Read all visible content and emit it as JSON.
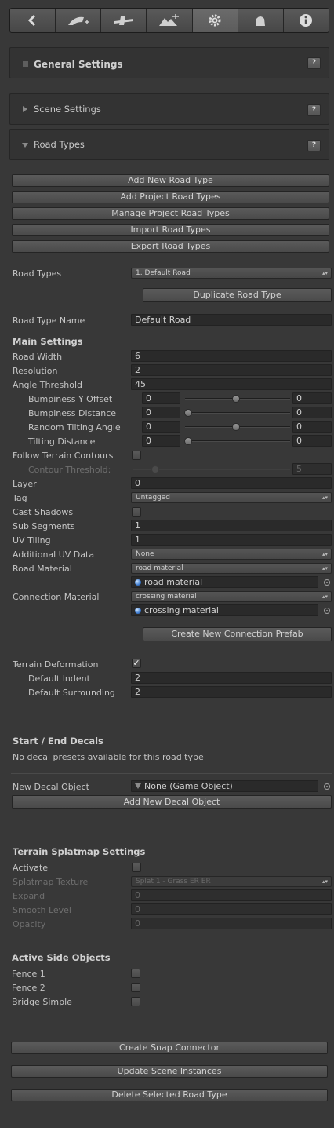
{
  "toolbar": {
    "icons": [
      "back-icon",
      "add-road-icon",
      "connection-icon",
      "terrain-tools-icon",
      "gear-icon",
      "object-icon",
      "info-icon"
    ],
    "active_index": 4
  },
  "panels": {
    "general": {
      "title": "General Settings",
      "help": "?"
    },
    "scene": {
      "title": "Scene Settings",
      "help": "?"
    },
    "road_types": {
      "title": "Road Types",
      "help": "?"
    }
  },
  "road_type_buttons": {
    "add_new": "Add New Road Type",
    "add_project": "Add Project Road Types",
    "manage_project": "Manage Project Road Types",
    "import": "Import Road Types",
    "export": "Export Road Types"
  },
  "road_types_row": {
    "label": "Road Types",
    "selected": "1. Default Road",
    "duplicate": "Duplicate Road Type"
  },
  "road_type_name": {
    "label": "Road Type Name",
    "value": "Default Road"
  },
  "main_settings": {
    "heading": "Main Settings",
    "road_width": {
      "label": "Road Width",
      "value": "6"
    },
    "resolution": {
      "label": "Resolution",
      "value": "2"
    },
    "angle_threshold": {
      "label": "Angle Threshold",
      "value": "45"
    },
    "bumpiness_y_offset": {
      "label": "Bumpiness Y Offset",
      "min": "0",
      "max": "0",
      "level": 0.5
    },
    "bumpiness_distance": {
      "label": "Bumpiness Distance",
      "min": "0",
      "max": "0",
      "level": 0.0
    },
    "random_tilting_angle": {
      "label": "Random Tilting Angle",
      "min": "0",
      "max": "0",
      "level": 0.5
    },
    "tilting_distance": {
      "label": "Tilting Distance",
      "min": "0",
      "max": "0",
      "level": 0.0
    },
    "follow_terrain_contours": {
      "label": "Follow Terrain Contours",
      "checked": false
    },
    "contour_threshold": {
      "label": "Contour Threshold:",
      "value": "5",
      "level": 0.0
    },
    "layer": {
      "label": "Layer",
      "value": "0"
    },
    "tag": {
      "label": "Tag",
      "value": "Untagged"
    },
    "cast_shadows": {
      "label": "Cast Shadows",
      "checked": false
    },
    "sub_segments": {
      "label": "Sub Segments",
      "value": "1"
    },
    "uv_tiling": {
      "label": "UV Tiling",
      "value": "1"
    },
    "additional_uv_data": {
      "label": "Additional UV Data",
      "value": "None"
    },
    "road_material": {
      "label": "Road Material",
      "dropdown": "road material",
      "object": "road material"
    },
    "connection_material": {
      "label": "Connection Material",
      "dropdown": "crossing material",
      "object": "crossing material"
    },
    "create_connection_prefab": "Create New Connection Prefab"
  },
  "terrain_deformation": {
    "label": "Terrain Deformation",
    "checked": true,
    "check_glyph": "✓",
    "default_indent": {
      "label": "Default Indent",
      "value": "2"
    },
    "default_surrounding": {
      "label": "Default Surrounding",
      "value": "2"
    }
  },
  "decals": {
    "heading": "Start / End Decals",
    "message": "No decal presets available for this road type",
    "new_decal_label": "New Decal Object",
    "new_decal_value": "None (Game Object)",
    "add_button": "Add New Decal Object"
  },
  "splatmap": {
    "heading": "Terrain Splatmap Settings",
    "activate": {
      "label": "Activate",
      "checked": false
    },
    "texture": {
      "label": "Splatmap Texture",
      "value": "Splat 1 - Grass ER ER"
    },
    "expand": {
      "label": "Expand",
      "value": "0"
    },
    "smooth": {
      "label": "Smooth Level",
      "value": "0"
    },
    "opacity": {
      "label": "Opacity",
      "value": "0"
    }
  },
  "side_objects": {
    "heading": "Active Side Objects",
    "items": [
      {
        "label": "Fence 1",
        "checked": false
      },
      {
        "label": "Fence 2",
        "checked": false
      },
      {
        "label": "Bridge Simple",
        "checked": false
      }
    ]
  },
  "bottom_buttons": {
    "snap": "Create Snap Connector",
    "update": "Update Scene Instances",
    "delete": "Delete Selected Road Type"
  }
}
